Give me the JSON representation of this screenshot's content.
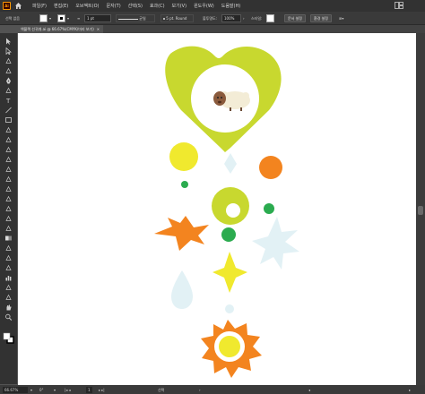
{
  "app": {
    "logo": "Ai"
  },
  "menu": [
    "파일(F)",
    "편집(E)",
    "오브젝트(O)",
    "문자(T)",
    "선택(S)",
    "효과(C)",
    "보기(V)",
    "윈도우(W)",
    "도움말(H)"
  ],
  "control": {
    "selection_label": "선택 없음",
    "stroke_weight": "1 pt",
    "profile_label": "균일",
    "brush_label": "5 pt. Round",
    "opacity_label": "불투명도:",
    "opacity_value": "100%",
    "style_label": "스타일:",
    "doc_setup_button": "문서 설정",
    "preferences_button": "환경 설정"
  },
  "document_tab": {
    "label": "액블랙 선귀개.ai @ 66.67%(CMYK/미리 보기)",
    "close": "×"
  },
  "status": {
    "zoom": "66.67%",
    "artboard_number": "1",
    "mode_label": "선택"
  },
  "artwork_colors": {
    "lime": "#c8d82f",
    "yellow": "#f0e92e",
    "orange": "#f3841f",
    "green": "#2bab4f",
    "pale_blue": "#e2f1f5",
    "sheep_brown": "#8a5a3c"
  },
  "tool_icons": [
    "selection-tool-icon",
    "direct-selection-tool-icon",
    "magic-wand-tool-icon",
    "lasso-tool-icon",
    "pen-tool-icon",
    "curvature-tool-icon",
    "type-tool-icon",
    "line-segment-tool-icon",
    "rectangle-tool-icon",
    "paintbrush-tool-icon",
    "pencil-tool-icon",
    "shaper-tool-icon",
    "eraser-tool-icon",
    "rotate-tool-icon",
    "scale-tool-icon",
    "width-tool-icon",
    "free-transform-tool-icon",
    "shape-builder-tool-icon",
    "perspective-grid-tool-icon",
    "mesh-tool-icon",
    "gradient-tool-icon",
    "eyedropper-tool-icon",
    "blend-tool-icon",
    "symbol-sprayer-tool-icon",
    "column-graph-tool-icon",
    "artboard-tool-icon",
    "slice-tool-icon",
    "hand-tool-icon",
    "zoom-tool-icon"
  ]
}
